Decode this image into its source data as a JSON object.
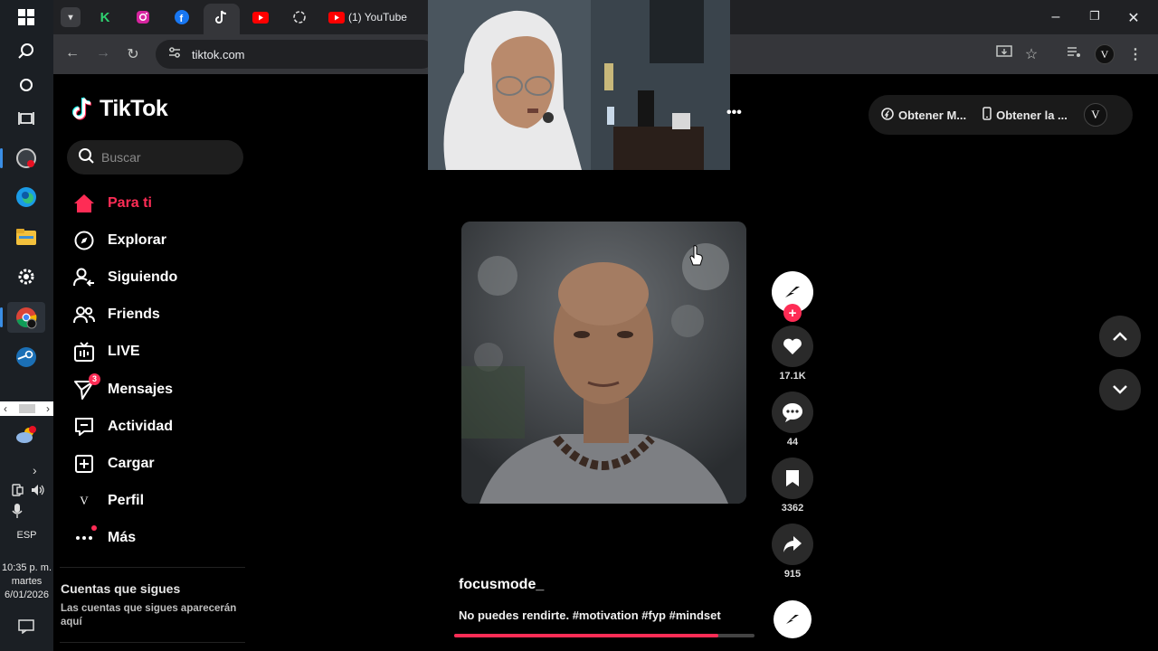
{
  "taskbar": {
    "icons": [
      "windows-start-icon",
      "search-icon",
      "cortana-icon",
      "task-view-icon",
      "app-icon",
      "edge-icon",
      "file-explorer-icon",
      "settings-icon",
      "chrome-icon",
      "steam-icon"
    ],
    "tray": {
      "lang": "ESP",
      "time": "10:35 p. m.",
      "weekday": "martes",
      "date": "6/01/2026"
    }
  },
  "browser": {
    "tab_title": "(1) YouTube",
    "url": "tiktok.com",
    "profile_initial": "V"
  },
  "tiktok": {
    "brand": "TikTok",
    "search_placeholder": "Buscar",
    "nav": [
      {
        "label": "Para ti",
        "icon": "home-icon"
      },
      {
        "label": "Explorar",
        "icon": "compass-icon"
      },
      {
        "label": "Siguiendo",
        "icon": "following-icon"
      },
      {
        "label": "Friends",
        "icon": "friends-icon"
      },
      {
        "label": "LIVE",
        "icon": "live-icon"
      },
      {
        "label": "Mensajes",
        "icon": "messages-icon",
        "badge": "3"
      },
      {
        "label": "Actividad",
        "icon": "activity-icon"
      },
      {
        "label": "Cargar",
        "icon": "upload-icon"
      },
      {
        "label": "Perfil",
        "icon": "profile-icon",
        "initial": "V"
      },
      {
        "label": "Más",
        "icon": "more-icon"
      }
    ],
    "following_title": "Cuentas que sigues",
    "following_desc": "Las cuentas que sigues aparecerán aquí",
    "top_actions": {
      "coins": "Obtener M...",
      "app": "Obtener la ...",
      "profile_initial": "V"
    },
    "video": {
      "author": "focusmode_",
      "description": "No puedes rendirte. #motivation #fyp #mindset",
      "progress": 0.88,
      "likes": "17.1K",
      "comments": "44",
      "saves": "3362",
      "shares": "915"
    }
  },
  "colors": {
    "accent": "#fe2c55",
    "background": "#000000",
    "chrome_toolbar": "#35363a"
  }
}
